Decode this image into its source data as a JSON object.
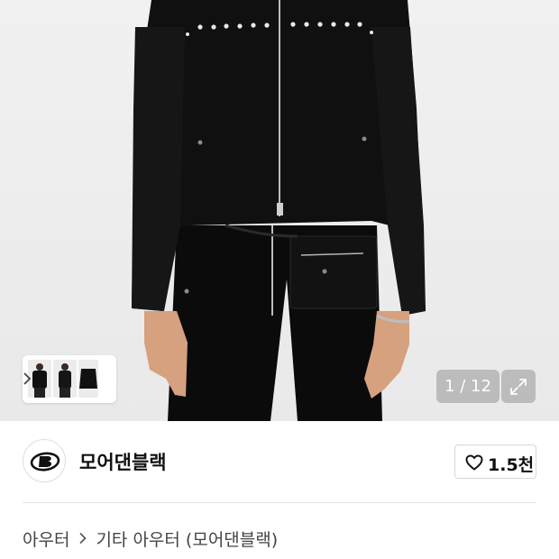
{
  "gallery": {
    "current_page": "1",
    "total_pages": "12",
    "counter_text": "1 / 12",
    "thumbnail_count": 3
  },
  "brand": {
    "name": "모어댄블랙"
  },
  "like": {
    "count_text": "1.5천"
  },
  "breadcrumb": {
    "level1": "아우터",
    "level2": "기타 아우터 (모어댄블랙)"
  },
  "colors": {
    "accent": "#111111",
    "product_black": "#0c0c0c",
    "background": "#ececec"
  },
  "icons": {
    "expand": "expand-icon",
    "heart": "heart-icon",
    "chevron": "chevron-right-icon"
  }
}
